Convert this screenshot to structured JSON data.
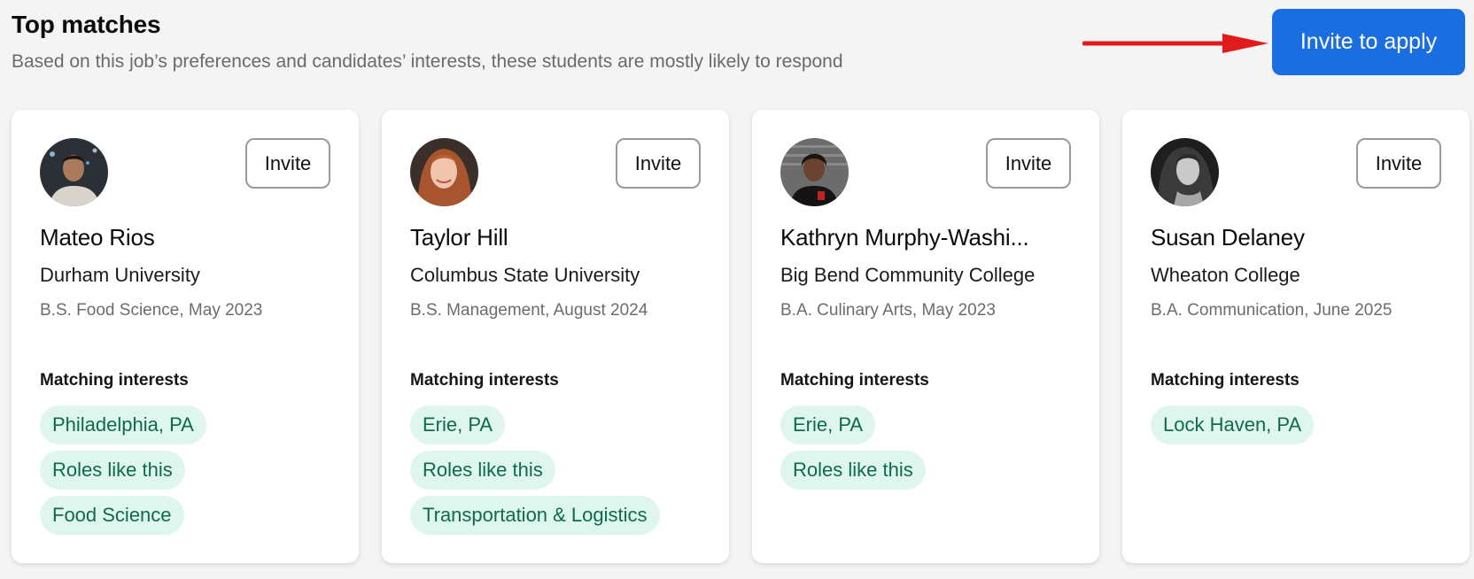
{
  "header": {
    "title": "Top matches",
    "subtitle": "Based on this job’s preferences and candidates’ interests, these students are mostly likely to respond"
  },
  "invite_apply_label": "Invite to apply",
  "invite_label": "Invite",
  "matching_label": "Matching interests",
  "colors": {
    "primary": "#1b6ee0",
    "tag_bg": "#dff6ef",
    "tag_text": "#0e6b4a",
    "arrow": "#e11b1b"
  },
  "candidates": [
    {
      "name": "Mateo Rios",
      "school": "Durham University",
      "degree": "B.S. Food Science, May 2023",
      "interests": [
        "Philadelphia, PA",
        "Roles like this",
        "Food Science"
      ]
    },
    {
      "name": "Taylor Hill",
      "school": "Columbus State University",
      "degree": "B.S. Management, August 2024",
      "interests": [
        "Erie, PA",
        "Roles like this",
        "Transportation & Logistics"
      ]
    },
    {
      "name": "Kathryn Murphy-Washi...",
      "school": "Big Bend Community College",
      "degree": "B.A. Culinary Arts, May 2023",
      "interests": [
        "Erie, PA",
        "Roles like this"
      ]
    },
    {
      "name": "Susan Delaney",
      "school": "Wheaton College",
      "degree": "B.A. Communication, June 2025",
      "interests": [
        "Lock Haven, PA"
      ]
    }
  ]
}
